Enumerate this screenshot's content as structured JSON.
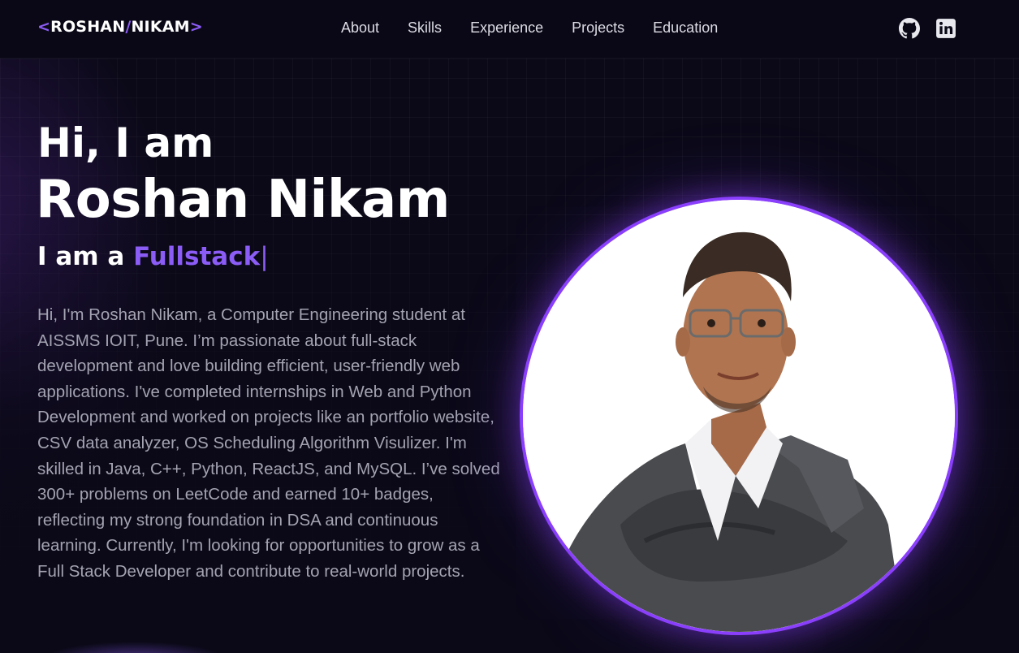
{
  "nav": {
    "logo": {
      "open": "<",
      "first": "ROSHAN",
      "slash": "/",
      "last": "NIKAM",
      "close": ">"
    },
    "links": [
      "About",
      "Skills",
      "Experience",
      "Projects",
      "Education"
    ],
    "social": [
      {
        "icon": "github-icon"
      },
      {
        "icon": "linkedin-icon"
      }
    ]
  },
  "hero": {
    "greeting": "Hi, I am",
    "name": "Roshan Nikam",
    "role_prefix": "I am a ",
    "role_typed": "Fullstack",
    "cursor": "|",
    "bio": "Hi, I'm Roshan Nikam, a Computer Engineering student at AISSMS IOIT, Pune. I’m passionate about full-stack development and love building efficient, user-friendly web applications. I've completed internships in Web and Python Development and worked on projects like an portfolio website, CSV data analyzer, OS Scheduling Algorithm Visulizer. I'm skilled in Java, C++, Python, ReactJS, and MySQL. I’ve solved 300+ problems on LeetCode and earned 10+ badges, reflecting my strong foundation in DSA and continuous learning. Currently, I'm looking for opportunities to grow as a Full Stack Developer and contribute to real-world projects."
  },
  "theme": {
    "accent": "#8b5cf6",
    "ring": "#8a3ffc",
    "background": "#0b0918",
    "text_muted": "#a3a3b2"
  }
}
